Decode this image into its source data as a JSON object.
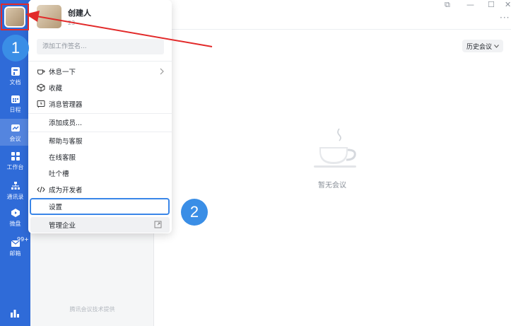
{
  "nav": {
    "items": [
      {
        "label": "文档",
        "icon": "document-icon"
      },
      {
        "label": "日程",
        "icon": "calendar-icon"
      },
      {
        "label": "会议",
        "icon": "meeting-icon"
      },
      {
        "label": "工作台",
        "icon": "workbench-icon"
      },
      {
        "label": "通讯录",
        "icon": "contacts-icon"
      },
      {
        "label": "微盘",
        "icon": "drive-icon"
      },
      {
        "label": "邮箱",
        "icon": "mail-icon"
      }
    ],
    "mail_badge": "99+"
  },
  "subcol": {
    "credit": "腾讯会议技术提供"
  },
  "main": {
    "history_button": "历史会议",
    "empty_text": "暂无会议"
  },
  "menu": {
    "user_name": "创建人",
    "user_sub": "23",
    "signature_placeholder": "添加工作签名...",
    "items": {
      "rest": "休息一下",
      "favorites": "收藏",
      "message_manager": "消息管理器",
      "add_member": "添加成员...",
      "help": "帮助与客服",
      "online_service": "在线客服",
      "feedback": "吐个槽",
      "developer": "成为开发者",
      "settings": "设置",
      "manage_company": "管理企业"
    }
  },
  "annotations": {
    "step1": "1",
    "step2": "2"
  },
  "colors": {
    "nav": "#2f6bd8",
    "step": "#3a8ee6",
    "arrow": "#e22a2a",
    "focus": "#3a86e8"
  }
}
